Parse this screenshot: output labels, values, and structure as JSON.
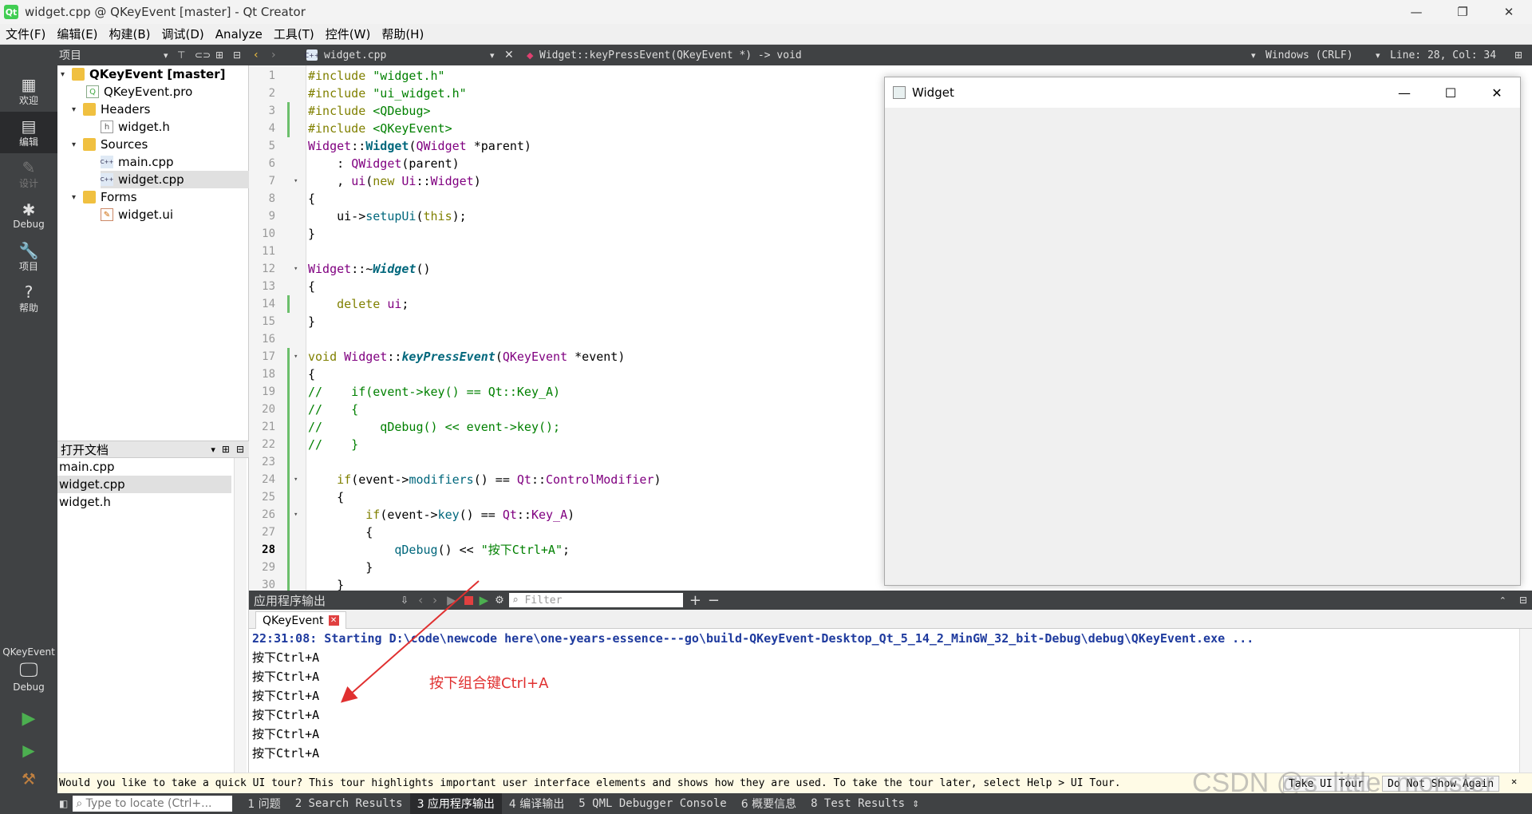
{
  "window": {
    "title": "widget.cpp @ QKeyEvent [master] - Qt Creator",
    "app_icon": "Qt",
    "minimize": "—",
    "maximize": "❐",
    "close": "✕"
  },
  "menu": [
    "文件(F)",
    "编辑(E)",
    "构建(B)",
    "调试(D)",
    "Analyze",
    "工具(T)",
    "控件(W)",
    "帮助(H)"
  ],
  "toolbar": {
    "project_label": "项目",
    "file_tab": "widget.cpp",
    "function_crumb": "Widget::keyPressEvent(QKeyEvent *) -> void",
    "line_ending": "Windows (CRLF)",
    "cursor": "Line: 28, Col: 34"
  },
  "modes": [
    {
      "label": "欢迎",
      "icon": "grid-icon",
      "glyph": "▦"
    },
    {
      "label": "编辑",
      "icon": "edit-icon",
      "glyph": "▤"
    },
    {
      "label": "设计",
      "icon": "pencil-icon",
      "glyph": "✎"
    },
    {
      "label": "Debug",
      "icon": "bug-icon",
      "glyph": "✱"
    },
    {
      "label": "项目",
      "icon": "wrench-icon",
      "glyph": "🔧"
    },
    {
      "label": "帮助",
      "icon": "help-icon",
      "glyph": "?"
    }
  ],
  "kit": {
    "project": "QKeyEvent",
    "config": "Debug"
  },
  "tree": {
    "root": "QKeyEvent [master]",
    "pro": "QKeyEvent.pro",
    "headers": "Headers",
    "widget_h": "widget.h",
    "sources": "Sources",
    "main_cpp": "main.cpp",
    "widget_cpp": "widget.cpp",
    "forms": "Forms",
    "widget_ui": "widget.ui"
  },
  "open_docs": {
    "title": "打开文档",
    "items": [
      "main.cpp",
      "widget.cpp",
      "widget.h"
    ]
  },
  "code": {
    "l1a": "#include ",
    "l1b": "\"widget.h\"",
    "l2a": "#include ",
    "l2b": "\"ui_widget.h\"",
    "l3a": "#include ",
    "l3b": "<QDebug>",
    "l4a": "#include ",
    "l4b": "<QKeyEvent>",
    "l5a": "Widget",
    "l5b": "::",
    "l5c": "Widget",
    "l5d": "(",
    "l5e": "QWidget",
    "l5f": " *parent)",
    "l6a": "    : ",
    "l6b": "QWidget",
    "l6c": "(parent)",
    "l7a": "    , ",
    "l7b": "ui",
    "l7c": "(",
    "l7d": "new ",
    "l7e": "Ui",
    "l7f": "::",
    "l7g": "Widget",
    "l7h": ")",
    "l8": "{",
    "l9a": "    ui->",
    "l9b": "setupUi",
    "l9c": "(",
    "l9d": "this",
    "l9e": ");",
    "l10": "}",
    "l12a": "Widget",
    "l12b": "::~",
    "l12c": "Widget",
    "l12d": "()",
    "l13": "{",
    "l14a": "    ",
    "l14b": "delete ",
    "l14c": "ui",
    "l14d": ";",
    "l15": "}",
    "l17a": "void ",
    "l17b": "Widget",
    "l17c": "::",
    "l17d": "keyPressEvent",
    "l17e": "(",
    "l17f": "QKeyEvent",
    "l17g": " *event)",
    "l18": "{",
    "l19": "//    if(event->key() == Qt::Key_A)",
    "l20": "//    {",
    "l21": "//        qDebug() << event->key();",
    "l22": "//    }",
    "l24a": "    ",
    "l24b": "if",
    "l24c": "(event->",
    "l24d": "modifiers",
    "l24e": "() == ",
    "l24f": "Qt",
    "l24g": "::",
    "l24h": "ControlModifier",
    "l24i": ")",
    "l25": "    {",
    "l26a": "        ",
    "l26b": "if",
    "l26c": "(event->",
    "l26d": "key",
    "l26e": "() == ",
    "l26f": "Qt",
    "l26g": "::",
    "l26h": "Key_A",
    "l26i": ")",
    "l27": "        {",
    "l28a": "            ",
    "l28b": "qDebug",
    "l28c": "() << ",
    "l28d": "\"按下Ctrl+A\"",
    "l28e": ";",
    "l29": "        }",
    "l30": "    }"
  },
  "line_numbers": [
    "1",
    "2",
    "3",
    "4",
    "5",
    "6",
    "7",
    "8",
    "9",
    "10",
    "11",
    "12",
    "13",
    "14",
    "15",
    "16",
    "17",
    "18",
    "19",
    "20",
    "21",
    "22",
    "23",
    "24",
    "25",
    "26",
    "27",
    "28",
    "29",
    "30"
  ],
  "widget_window": {
    "title": "Widget",
    "minimize": "—",
    "maximize": "☐",
    "close": "✕"
  },
  "output": {
    "pane_title": "应用程序输出",
    "filter_placeholder": "Filter",
    "tab": "QKeyEvent",
    "start_line": "22:31:08: Starting D:\\code\\newcode here\\one-years-essence---go\\build-QKeyEvent-Desktop_Qt_5_14_2_MinGW_32_bit-Debug\\debug\\QKeyEvent.exe ...",
    "lines": [
      "按下Ctrl+A",
      "按下Ctrl+A",
      "按下Ctrl+A",
      "按下Ctrl+A",
      "按下Ctrl+A",
      "按下Ctrl+A"
    ],
    "annotation": "按下组合键Ctrl+A",
    "annotation_color": "#e03030"
  },
  "tour": {
    "message": "Would you like to take a quick UI tour? This tour highlights important user interface elements and shows how they are used. To take the tour later, select Help > UI Tour.",
    "take_btn": "Take UI Tour",
    "dont_show_btn": "Do Not Show Again"
  },
  "status": {
    "locate_placeholder": "Type to locate (Ctrl+...",
    "tabs": [
      "1 问题",
      "2 Search Results",
      "3 应用程序输出",
      "4 编译输出",
      "5 QML Debugger Console",
      "6 概要信息",
      "8 Test Results"
    ]
  },
  "watermark": "CSDN @s_little_monster"
}
